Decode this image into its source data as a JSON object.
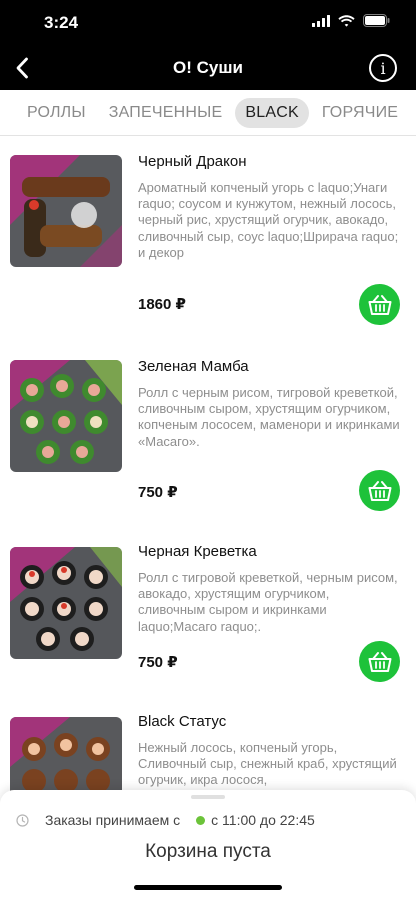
{
  "status_bar": {
    "time": "3:24"
  },
  "nav": {
    "title": "O! Суши",
    "info_label": "i"
  },
  "tabs": [
    {
      "label": "РОЛЛЫ",
      "active": false
    },
    {
      "label": "ЗАПЕЧЕННЫЕ",
      "active": false
    },
    {
      "label": "BLACK",
      "active": true
    },
    {
      "label": "ГОРЯЧИЕ",
      "active": false
    }
  ],
  "products": [
    {
      "title": "Черный Дракон",
      "description": "Ароматный копченый угорь с laquo;Унаги raquo; соусом и кунжутом, нежный лосось, черный рис, хрустящий огурчик, авокадо, сливочный сыр, соус laquo;Шрирача raquo; и декор",
      "price": "1860 ₽"
    },
    {
      "title": "Зеленая Мамба",
      "description": "Ролл с черным рисом, тигровой креветкой, сливочным сыром, хрустящим огурчиком, копченым лососем, маменори и икринками «Масаго».",
      "price": "750 ₽"
    },
    {
      "title": "Черная Креветка",
      "description": "Ролл с тигровой креветкой, черным рисом, авокадо, хрустящим огурчиком, сливочным сыром и икринками laquo;Масаго raquo;.",
      "price": "750 ₽"
    },
    {
      "title": "Black Статус",
      "description": "Нежный лосось, копченый угорь, Сливочный сыр, снежный краб, хрустящий огурчик, икра лосося,",
      "price": ""
    }
  ],
  "bottom_sheet": {
    "hours_label": "Заказы принимаем с",
    "hours_value": "с 11:00 до 22:45",
    "cart_status": "Корзина пуста"
  },
  "colors": {
    "accent_green": "#1ec23a",
    "open_dot": "#6cc33a",
    "header_bg": "#000000"
  },
  "icons": {
    "back": "chevron-left-icon",
    "info": "info-icon",
    "cart": "basket-icon",
    "clock": "clock-icon"
  }
}
